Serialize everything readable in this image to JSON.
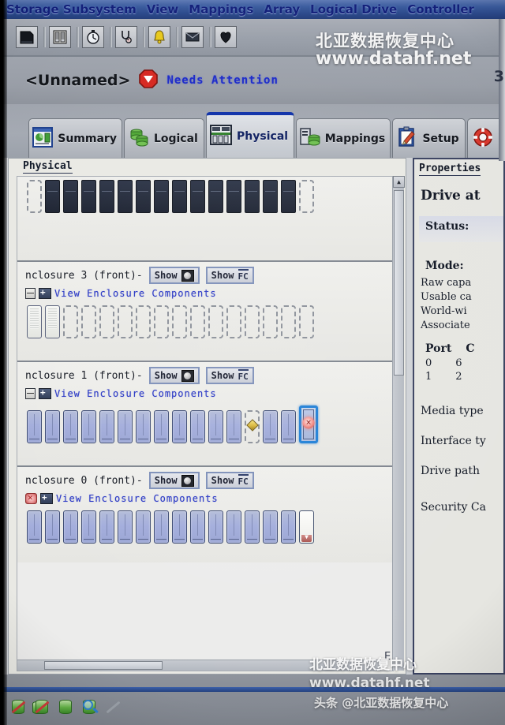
{
  "menubar": {
    "items": [
      {
        "label": "Storage Subsystem"
      },
      {
        "label": "View"
      },
      {
        "label": "Mappings"
      },
      {
        "label": "Array"
      },
      {
        "label": "Logical Drive"
      },
      {
        "label": "Controller"
      }
    ]
  },
  "toolbar": {
    "buttons": [
      {
        "name": "new-storage-subsystem-icon"
      },
      {
        "name": "enclosure-icon"
      },
      {
        "name": "clock-icon"
      },
      {
        "name": "stethoscope-icon"
      },
      {
        "name": "alarm-bell-icon"
      },
      {
        "name": "mail-icon"
      },
      {
        "name": "heart-icon"
      }
    ]
  },
  "subsystem_header": {
    "name": "<Unnamed>",
    "status_icon": "needs-attention-icon",
    "status_text": "Needs Attention",
    "status_color": "#1a28c8"
  },
  "tabs": [
    {
      "label": "Summary",
      "icon": "summary-chart-icon",
      "active": false
    },
    {
      "label": "Logical",
      "icon": "logical-drives-icon",
      "active": false
    },
    {
      "label": "Physical",
      "icon": "physical-enclosure-icon",
      "active": true
    },
    {
      "label": "Mappings",
      "icon": "mappings-icon",
      "active": false
    },
    {
      "label": "Setup",
      "icon": "setup-clipboard-icon",
      "active": false
    },
    {
      "label": "",
      "icon": "support-lifering-icon",
      "active": false
    }
  ],
  "physical_pane": {
    "title": "Physical",
    "enclosures": [
      {
        "label": "",
        "partial": true,
        "show_drive_label": "",
        "show_fc_label": "",
        "link_label": "",
        "slots": [
          "empty",
          "dark",
          "dark",
          "dark",
          "dark",
          "dark",
          "dark",
          "dark",
          "dark",
          "dark",
          "dark",
          "dark",
          "dark",
          "dark",
          "dark",
          "empty"
        ]
      },
      {
        "label": "nclosure 3 (front)-",
        "partial": false,
        "show_drive_label": "Show",
        "show_fc_label": "Show",
        "fc_text": "FC",
        "link_label": "View Enclosure Components",
        "slots": [
          "ribbed",
          "ribbed",
          "empty",
          "empty",
          "empty",
          "empty",
          "empty",
          "empty",
          "empty",
          "empty",
          "empty",
          "empty",
          "empty",
          "empty",
          "empty",
          "empty"
        ]
      },
      {
        "label": "nclosure 1 (front)-",
        "partial": false,
        "show_drive_label": "Show",
        "show_fc_label": "Show",
        "fc_text": "FC",
        "link_label": "View Enclosure Components",
        "slots": [
          "drive",
          "drive",
          "drive",
          "drive",
          "drive",
          "drive",
          "drive",
          "drive",
          "drive",
          "drive",
          "drive",
          "drive",
          "warn",
          "drive",
          "drive",
          "selected"
        ]
      },
      {
        "label": "nclosure 0 (front)-",
        "partial": false,
        "show_drive_label": "Show",
        "show_fc_label": "Show",
        "fc_text": "FC",
        "link_label": "View Enclosure Components",
        "slots": [
          "drive",
          "drive",
          "drive",
          "drive",
          "drive",
          "drive",
          "drive",
          "drive",
          "drive",
          "drive",
          "drive",
          "drive",
          "drive",
          "drive",
          "drive",
          "white"
        ]
      }
    ]
  },
  "properties_pane": {
    "title": "Properties",
    "heading": "Drive at",
    "status_label": "Status:",
    "mode_label": "Mode:",
    "rows": [
      "Raw capa",
      "Usable ca",
      "World-wi",
      "Associate"
    ],
    "port_table": {
      "headers": [
        "Port",
        "C"
      ],
      "rows": [
        [
          "0",
          "6"
        ],
        [
          "1",
          "2"
        ]
      ]
    },
    "footer_rows": [
      "Media type",
      "Interface ty",
      "Drive path",
      "Security Ca"
    ]
  },
  "statusbar": {
    "icons": [
      {
        "name": "disabled-drive-icon"
      },
      {
        "name": "disabled-array-icon"
      },
      {
        "name": "drive-icon"
      },
      {
        "name": "find-drive-icon"
      },
      {
        "name": "disabled-pencil-icon"
      }
    ]
  },
  "watermark": {
    "line1": "北亚数据恢复中心",
    "line2": "www.datahf.net",
    "line3": "北亚数据恢复中心",
    "line4": "www.datahf.net",
    "line5": "头条 @北亚数据恢复中心"
  },
  "right_edge": {
    "char": "3"
  },
  "misc": {
    "scroll_marker": "E"
  }
}
